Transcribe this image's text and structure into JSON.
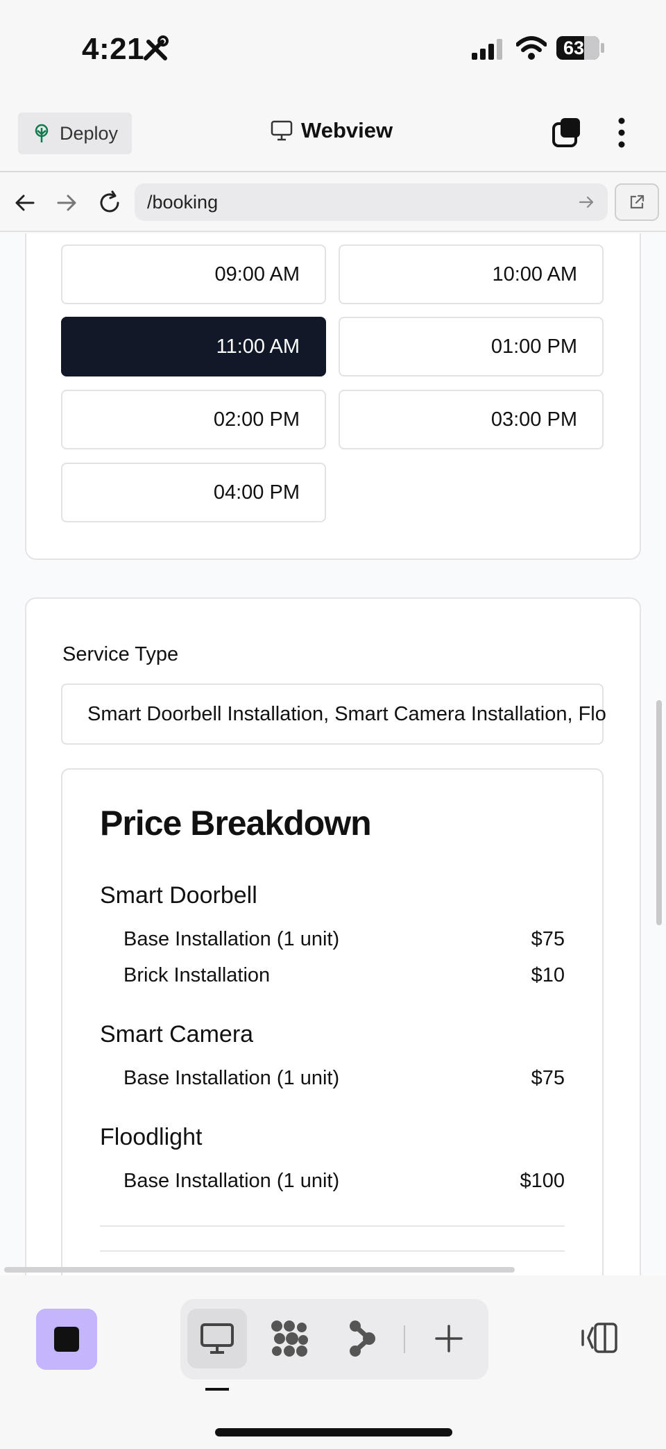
{
  "status_bar": {
    "time": "4:21",
    "battery": "63"
  },
  "header": {
    "deploy_label": "Deploy",
    "title": "Webview"
  },
  "address_bar": {
    "url": "/booking"
  },
  "time_slots": [
    {
      "label": "09:00 AM",
      "selected": false
    },
    {
      "label": "10:00 AM",
      "selected": false
    },
    {
      "label": "11:00 AM",
      "selected": true
    },
    {
      "label": "01:00 PM",
      "selected": false
    },
    {
      "label": "02:00 PM",
      "selected": false
    },
    {
      "label": "03:00 PM",
      "selected": false
    },
    {
      "label": "04:00 PM",
      "selected": false
    }
  ],
  "service": {
    "label": "Service Type",
    "value": "Smart Doorbell Installation, Smart Camera Installation, Flo"
  },
  "price_breakdown": {
    "title": "Price Breakdown",
    "sections": [
      {
        "name": "Smart Doorbell",
        "items": [
          {
            "label": "Base Installation (1 unit)",
            "price": "$75"
          },
          {
            "label": "Brick Installation",
            "price": "$10"
          }
        ]
      },
      {
        "name": "Smart Camera",
        "items": [
          {
            "label": "Base Installation (1 unit)",
            "price": "$75"
          }
        ]
      },
      {
        "name": "Floodlight",
        "items": [
          {
            "label": "Base Installation (1 unit)",
            "price": "$100"
          }
        ]
      }
    ]
  },
  "colors": {
    "selected_slot": "#111827",
    "stop_button": "#c4b5fd"
  }
}
